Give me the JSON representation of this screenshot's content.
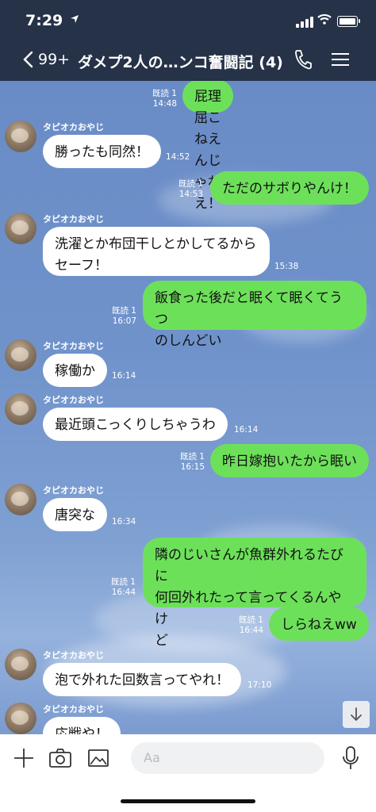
{
  "status": {
    "time": "7:29"
  },
  "header": {
    "back_count": "99+",
    "title": "ダメプ2人の…ンコ奮闘記 (4)"
  },
  "messages": [
    {
      "dir": "out",
      "text": "屁理屈こねえんじゃねえ！",
      "read": "既読 1",
      "time": "14:48"
    },
    {
      "dir": "in",
      "sender": "タピオカおやじ",
      "text": "勝ったも同然！",
      "time": "14:52"
    },
    {
      "dir": "out",
      "text": "ただのサボりやんけ！",
      "read": "既読 1",
      "time": "14:53"
    },
    {
      "dir": "in",
      "sender": "タピオカおやじ",
      "line1": "洗濯とか布団干しとかしてるから",
      "line2": "セーフ！",
      "time": "15:38"
    },
    {
      "dir": "out",
      "line1": "飯食った後だと眠くて眠くてうつ",
      "line2": "のしんどい",
      "read": "既読 1",
      "time": "16:07"
    },
    {
      "dir": "in",
      "sender": "タピオカおやじ",
      "text": "稼働か",
      "time": "16:14"
    },
    {
      "dir": "in",
      "sender": "タピオカおやじ",
      "text": "最近頭こっくりしちゃうわ",
      "time": "16:14"
    },
    {
      "dir": "out",
      "text": "昨日嫁抱いたから眠い",
      "read": "既読 1",
      "time": "16:15"
    },
    {
      "dir": "in",
      "sender": "タピオカおやじ",
      "text": "唐突な",
      "time": "16:34"
    },
    {
      "dir": "out",
      "line1": "隣のじいさんが魚群外れるたびに",
      "line2": "何回外れたって言ってくるんやけ",
      "line3": "ど",
      "read": "既読 1",
      "time": "16:44"
    },
    {
      "dir": "out",
      "text": "しらねえww",
      "read": "既読 1",
      "time": "16:44"
    },
    {
      "dir": "in",
      "sender": "タピオカおやじ",
      "text": "泡で外れた回数言ってやれ！",
      "time": "17:10"
    },
    {
      "dir": "in",
      "sender": "タピオカおやじ",
      "text": "応戦や！"
    }
  ],
  "input": {
    "placeholder": "Aa"
  },
  "icons": {
    "back": "chevron-left-icon",
    "phone": "phone-icon",
    "menu": "menu-icon",
    "plus": "plus-icon",
    "camera": "camera-icon",
    "image": "image-icon",
    "emoji": "emoji-icon",
    "mic": "mic-icon",
    "scroll": "arrow-down-icon"
  },
  "colors": {
    "header_bg": "#253247",
    "out_bubble": "#6de05a",
    "in_bubble": "#ffffff",
    "chat_bg": "#6f92cb"
  }
}
